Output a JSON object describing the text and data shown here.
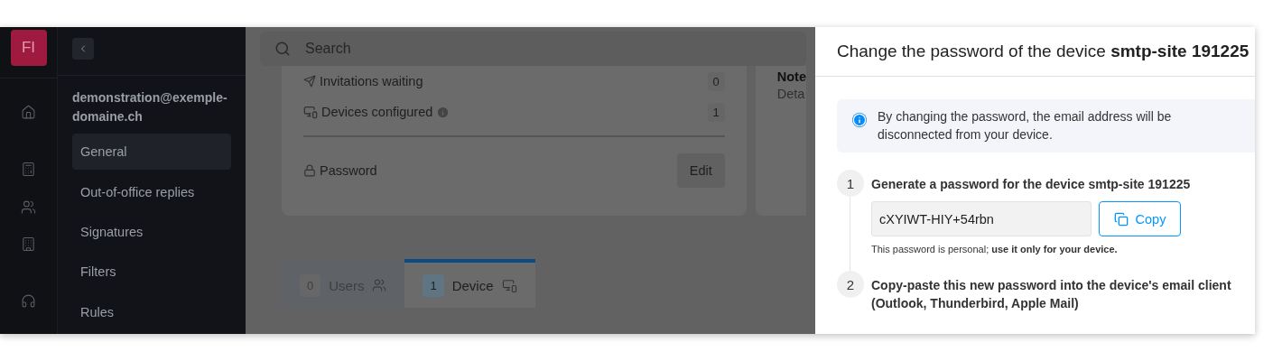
{
  "app_logo": "FI",
  "nav": {
    "account": "demonstration@exemple-domaine.ch",
    "items": [
      {
        "label": "General",
        "selected": true
      },
      {
        "label": "Out-of-office replies",
        "selected": false
      },
      {
        "label": "Signatures",
        "selected": false
      },
      {
        "label": "Filters",
        "selected": false
      },
      {
        "label": "Rules",
        "selected": false
      }
    ]
  },
  "search": {
    "placeholder": "Search"
  },
  "summary": {
    "rows": [
      {
        "kind": "invitations",
        "label": "Invitations waiting",
        "value": "0",
        "info": false
      },
      {
        "kind": "devices",
        "label": "Devices configured",
        "value": "1",
        "info": true
      }
    ],
    "password": {
      "label": "Password",
      "button": "Edit"
    }
  },
  "notes": {
    "title": "Note",
    "subtitle": "Deta"
  },
  "tabs": [
    {
      "count": "0",
      "label": "Users",
      "kind": "users",
      "selected": false
    },
    {
      "count": "1",
      "label": "Device",
      "kind": "device",
      "selected": true
    }
  ],
  "panel": {
    "title": "Change the password of the device **smtp-site 191225**",
    "notice": "By changing the password, the email address will be disconnected from your device.",
    "steps": [
      {
        "number": "1",
        "title": "Generate a password for the device smtp-site 191225",
        "password": "cXYIWT-HIY+54rbn",
        "copy": "Copy",
        "hint": "This password is personal; **use it only for your device.**"
      },
      {
        "number": "2",
        "title": "Copy-paste this new password into the device's email client (Outlook, Thunderbird, Apple Mail)"
      }
    ]
  }
}
